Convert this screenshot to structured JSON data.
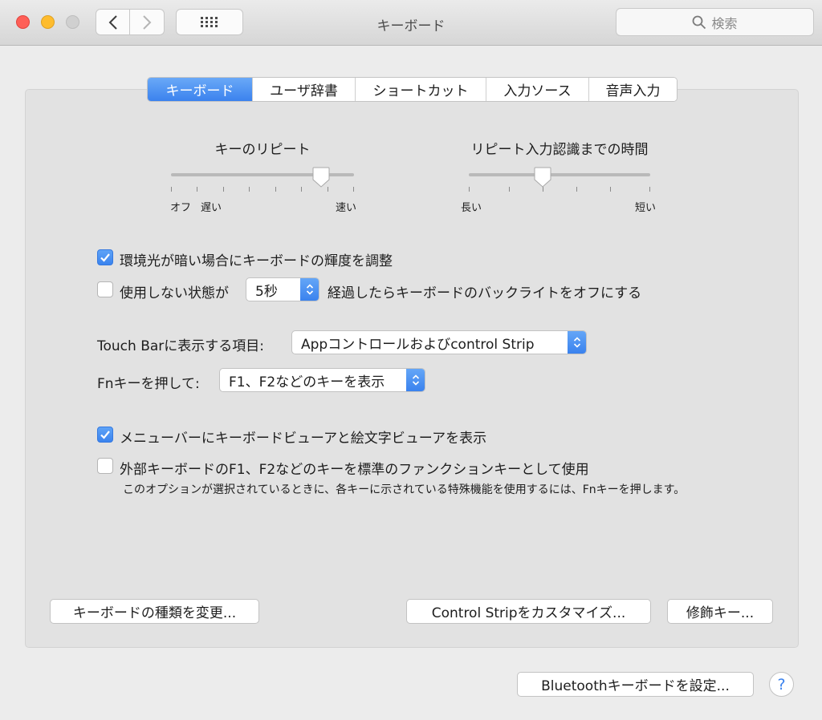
{
  "window": {
    "title": "キーボード",
    "search_placeholder": "検索"
  },
  "tabs": [
    {
      "label": "キーボード",
      "active": true
    },
    {
      "label": "ユーザ辞書",
      "active": false
    },
    {
      "label": "ショートカット",
      "active": false
    },
    {
      "label": "入力ソース",
      "active": false
    },
    {
      "label": "音声入力",
      "active": false
    }
  ],
  "key_repeat": {
    "label": "キーのリピート",
    "left_label": "オフ",
    "slow_label": "遅い",
    "right_label": "速い",
    "value_fraction": 0.83
  },
  "repeat_delay": {
    "label": "リピート入力認識までの時間",
    "left_label": "長い",
    "right_label": "短い",
    "value_fraction": 0.4
  },
  "options": {
    "auto_brightness": {
      "label": "環境光が暗い場合にキーボードの輝度を調整",
      "checked": true
    },
    "backlight_off": {
      "label_before": "使用しない状態が",
      "value": "5秒",
      "label_after": "経過したらキーボードのバックライトをオフにする",
      "checked": false
    },
    "touchbar": {
      "label": "Touch Barに表示する項目:",
      "value": "Appコントロールおよびcontrol Strip"
    },
    "fn_key": {
      "label": "Fnキーを押して:",
      "value": "F1、F2などのキーを表示"
    },
    "menubar_viewer": {
      "label": "メニューバーにキーボードビューアと絵文字ビューアを表示",
      "checked": true
    },
    "fn_standard": {
      "label": "外部キーボードのF1、F2などのキーを標準のファンクションキーとして使用",
      "note": "このオプションが選択されているときに、各キーに示されている特殊機能を使用するには、Fnキーを押します。",
      "checked": false
    }
  },
  "buttons": {
    "change_type": "キーボードの種類を変更...",
    "customize_strip": "Control Stripをカスタマイズ...",
    "modifier": "修飾キー...",
    "bluetooth": "Bluetoothキーボードを設定...",
    "help": "?"
  },
  "colors": {
    "accent": "#3b82ee",
    "close": "#fe5f57",
    "minimize": "#febc2e",
    "zoom_disabled": "#d0d0d0"
  }
}
